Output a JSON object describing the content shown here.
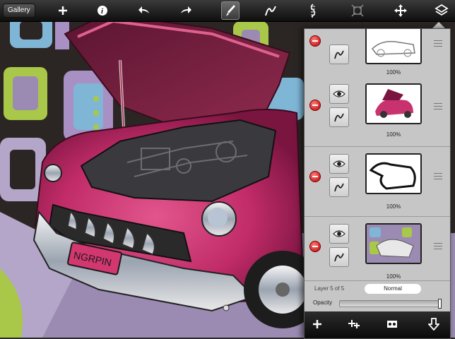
{
  "toolbar": {
    "gallery_label": "Gallery",
    "icons": [
      "plus-icon",
      "info-icon",
      "undo-icon",
      "redo-icon",
      "brush-icon",
      "stroke-icon",
      "smudge-icon",
      "transform-icon",
      "move-icon",
      "layers-icon"
    ]
  },
  "layers_panel": {
    "layers": [
      {
        "opacity": "100%"
      },
      {
        "opacity": "100%"
      },
      {
        "opacity": "100%"
      },
      {
        "opacity": "100%"
      }
    ],
    "layer_count": "Layer 5 of 5",
    "blend_mode": "Normal",
    "opacity_label": "Opacity",
    "opacity_value": 1.0,
    "bottom_icons": [
      "add-layer-icon",
      "duplicate-layer-icon",
      "merge-layer-icon",
      "merge-down-icon"
    ]
  },
  "colors": {
    "car_body": "#c8336f",
    "background_dark": "#2b2624",
    "accent_green": "#a9c84a",
    "accent_blue": "#7fb6d6",
    "accent_purple": "#a88fc4"
  }
}
